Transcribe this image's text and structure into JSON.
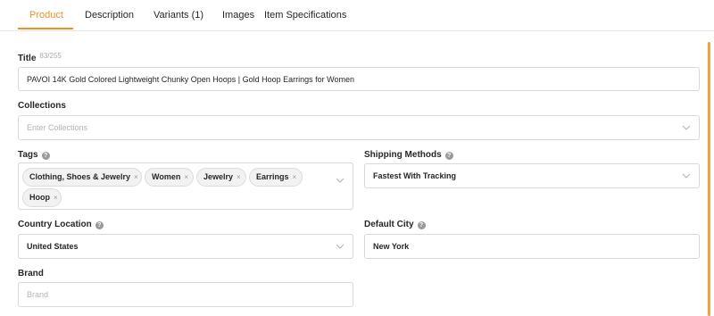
{
  "tabs": [
    {
      "label": "Product"
    },
    {
      "label": "Description"
    },
    {
      "label": "Variants (1)"
    },
    {
      "label": "Images"
    },
    {
      "label": "Item Specifications"
    }
  ],
  "title": {
    "label": "Title",
    "counter": "83/255",
    "value": "PAVOI 14K Gold Colored Lightweight Chunky Open Hoops | Gold Hoop Earrings for Women"
  },
  "collections": {
    "label": "Collections",
    "placeholder": "Enter Collections"
  },
  "tags": {
    "label": "Tags",
    "items": [
      {
        "label": "Clothing, Shoes & Jewelry"
      },
      {
        "label": "Women"
      },
      {
        "label": "Jewelry"
      },
      {
        "label": "Earrings"
      },
      {
        "label": "Hoop"
      }
    ]
  },
  "shipping": {
    "label": "Shipping Methods",
    "value": "Fastest With Tracking"
  },
  "country": {
    "label": "Country Location",
    "value": "United States"
  },
  "city": {
    "label": "Default City",
    "value": "New York"
  },
  "brand": {
    "label": "Brand",
    "placeholder": "Brand"
  },
  "colors": {
    "accent": "#f0902a",
    "border": "#d9d9d9"
  }
}
